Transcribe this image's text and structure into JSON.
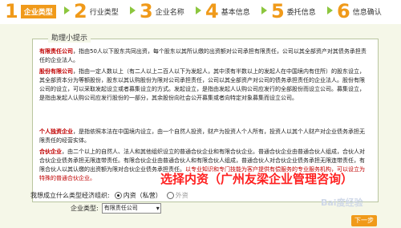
{
  "steps": [
    {
      "num": "1",
      "label": "企业类型"
    },
    {
      "num": "2",
      "label": "行业类型"
    },
    {
      "num": "3",
      "label": "企业名称"
    },
    {
      "num": "4",
      "label": "基本信息"
    },
    {
      "num": "5",
      "label": "委托信息"
    },
    {
      "num": "6",
      "label": "信息确认"
    }
  ],
  "help": {
    "title": "助理小提示",
    "p1_kw": "有限责任公司",
    "p1": "，指由50人以下股东共同出资，每个股东以其所认缴的出资额对公司承担有限责任，公司以其全部资产对其债务承担责任的企业法人。",
    "p2_kw": "股份有限公司",
    "p2": "，指由一定人数以上（有二人以上二百人以下为发起人，其中须有半数以上的发起人在中国境内有住所）的股东设立，其全部资本分为等额股份，股东以其认购股份为限对公司承担责任，公司以其全部资产对公司的债务承担责任的企业法人。股份有限公司的设立，可以采取发起设立或者募集设立的方式。发起设立，是指由发起人认购公司应发行的全部股份而设立公司。募集设立，是指由发起人认购公司应发行股份的一部分，其余股份向社会公开募集或者向特定对象募集而设立公司。",
    "p3_kw": "个人独资企业",
    "p3": "，是指依照本法在中国境内设立，由一个自然人投资，财产为投资人个人所有，投资人以其个人财产对企业债务承担无限责任的经营实体。",
    "p4_kw": "合伙企业",
    "p4": "，由二个以上的自然人、法人和其他组织设立的普通合伙企业和有限合伙企业。普通合伙企业由普通合伙人组成，合伙人对合伙企业债务承担无限连带责任。有限合伙企业由普通合伙人和有限合伙人组成，普通合伙人对合伙企业债务承担无限连带责任，有限合伙人以其认缴的出资额为限对合伙企业债务承担责任。",
    "p4_red": "以专业知识和专门技能为客户提供有偿服务的专业服务机构，可以设立为特殊的普通合伙企业。"
  },
  "overlay": "选择内资（广州友梁企业管理咨询）",
  "form": {
    "econ_label": "我想成立什么类型经济组织:",
    "opt_domestic": "内资（私营）",
    "opt_foreign": "外资",
    "type_label": "企业类型:",
    "type_value": "有限责任公司"
  },
  "next": "下一步",
  "watermark": "Bai度经验"
}
